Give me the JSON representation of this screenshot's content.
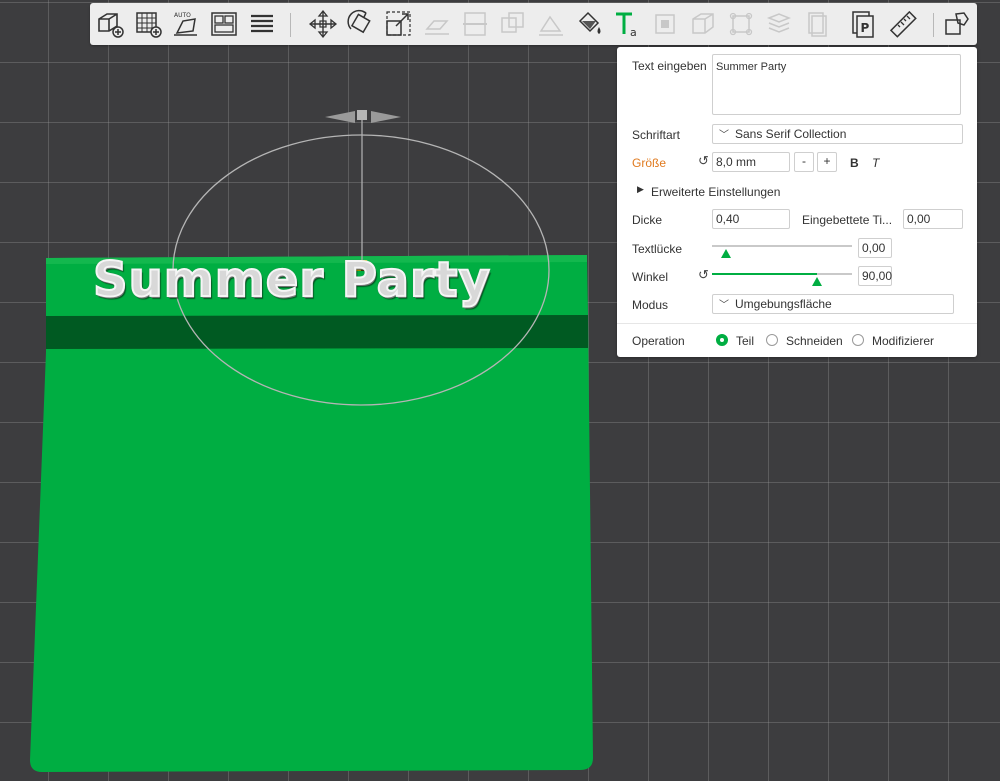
{
  "scene": {
    "model_text": "Summer Party"
  },
  "toolbar": {
    "buttons": [
      {
        "name": "add-part-icon"
      },
      {
        "name": "add-plate-icon"
      },
      {
        "name": "auto-orient-icon"
      },
      {
        "name": "arrange-icon"
      },
      {
        "name": "layers-icon"
      },
      {
        "name": "move-icon"
      },
      {
        "name": "rotate-icon"
      },
      {
        "name": "scale-icon"
      },
      {
        "name": "lay-on-face-icon"
      },
      {
        "name": "cut-icon"
      },
      {
        "name": "mesh-boolean-icon"
      },
      {
        "name": "support-paint-icon"
      },
      {
        "name": "color-paint-icon"
      },
      {
        "name": "text-tool-icon"
      },
      {
        "name": "emboss-icon"
      },
      {
        "name": "box-icon"
      },
      {
        "name": "assembly-icon"
      },
      {
        "name": "variable-layer-icon"
      },
      {
        "name": "seam-icon"
      },
      {
        "name": "svg-part-icon"
      },
      {
        "name": "measure-icon"
      },
      {
        "name": "split-icon"
      }
    ]
  },
  "text_panel": {
    "input_label": "Text eingeben",
    "input_value": "Summer Party",
    "font_label": "Schriftart",
    "font_value": "Sans Serif Collection",
    "size_label": "Größe",
    "size_value": "8,0 mm",
    "minus": "-",
    "plus": "+",
    "bold": "B",
    "italic": "T",
    "advanced_label": "Erweiterte Einstellungen",
    "depth_label": "Dicke",
    "depth_value": "0,40",
    "embedded_label": "Eingebettete Ti...",
    "embedded_value": "0,00",
    "gap_label": "Textlücke",
    "gap_value": "0,00",
    "gap_fraction": 0.1,
    "angle_label": "Winkel",
    "angle_value": "90,00",
    "angle_fraction": 0.75,
    "mode_label": "Modus",
    "mode_value": "Umgebungsfläche",
    "operation_label": "Operation",
    "operations": [
      {
        "label": "Teil",
        "selected": true
      },
      {
        "label": "Schneiden",
        "selected": false
      },
      {
        "label": "Modifizierer",
        "selected": false
      }
    ]
  },
  "colors": {
    "accent": "#00ae42",
    "plate_green": "#00ae42",
    "dark_green": "#006d2a",
    "highlight_label": "#e07a1f",
    "background": "#3d3d3f"
  }
}
